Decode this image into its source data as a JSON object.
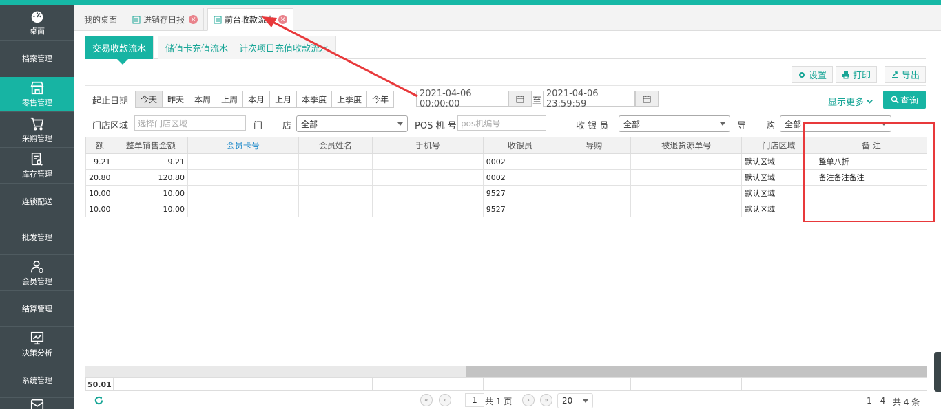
{
  "sidebar": {
    "items": [
      {
        "label": "桌面",
        "icon": "dashboard-icon"
      },
      {
        "label": "档案管理",
        "icon": ""
      },
      {
        "label": "零售管理",
        "icon": "store-icon"
      },
      {
        "label": "采购管理",
        "icon": "cart-icon"
      },
      {
        "label": "库存管理",
        "icon": "inventory-search-icon"
      },
      {
        "label": "连锁配送",
        "icon": ""
      },
      {
        "label": "批发管理",
        "icon": ""
      },
      {
        "label": "会员管理",
        "icon": "member-icon"
      },
      {
        "label": "结算管理",
        "icon": ""
      },
      {
        "label": "决策分析",
        "icon": "analytics-icon"
      },
      {
        "label": "系统管理",
        "icon": ""
      },
      {
        "label": "",
        "icon": "inbox-icon"
      }
    ],
    "active_label": "零售管理"
  },
  "tabs": [
    {
      "label": "我的桌面",
      "closable": false
    },
    {
      "label": "进销存日报",
      "closable": true
    },
    {
      "label": "前台收款流水",
      "closable": true
    }
  ],
  "subtabs": [
    "交易收款流水",
    "储值卡充值流水",
    "计次项目充值收款流水"
  ],
  "toolbar": {
    "settings": "设置",
    "print": "打印",
    "export": "导出"
  },
  "filters": {
    "date_label": "起止日期",
    "quick_ranges": [
      "今天",
      "昨天",
      "本周",
      "上周",
      "本月",
      "上月",
      "本季度",
      "上季度",
      "今年"
    ],
    "selected_range": "今天",
    "start_date": "2021-04-06 00:00:00",
    "to_label": "至",
    "end_date": "2021-04-06 23:59:59",
    "more_label": "显示更多",
    "query_label": "查询",
    "area_label": "门店区域",
    "area_placeholder": "选择门店区域",
    "store_label_1": "门",
    "store_label_2": "店",
    "store_value": "全部",
    "pos_label": "POS 机 号",
    "pos_placeholder": "pos机编号",
    "cashier_label": "收 银 员",
    "cashier_value": "全部",
    "guide_label_1": "导",
    "guide_label_2": "购",
    "guide_value": "全部"
  },
  "grid": {
    "columns": [
      "额",
      "整单销售金额",
      "会员卡号",
      "会员姓名",
      "手机号",
      "收银员",
      "导购",
      "被退货源单号",
      "门店区域",
      "备 注"
    ],
    "rows": [
      [
        "9.21",
        "9.21",
        "",
        "",
        "",
        "0002",
        "",
        "",
        "默认区域",
        "整单八折"
      ],
      [
        "20.80",
        "120.80",
        "",
        "",
        "",
        "0002",
        "",
        "",
        "默认区域",
        "备注备注备注"
      ],
      [
        "10.00",
        "10.00",
        "",
        "",
        "",
        "9527",
        "",
        "",
        "默认区域",
        ""
      ],
      [
        "10.00",
        "10.00",
        "",
        "",
        "",
        "9527",
        "",
        "",
        "默认区域",
        ""
      ]
    ],
    "footer_total": "50.01"
  },
  "pager": {
    "page": "1",
    "total_pages": "共 1 页",
    "page_size": "20",
    "range": "1 - 4",
    "total": "共 4 条"
  },
  "colors": {
    "accent": "#17b4a3",
    "sidebar": "#3f4a4f",
    "annotation": "#e8393b"
  }
}
